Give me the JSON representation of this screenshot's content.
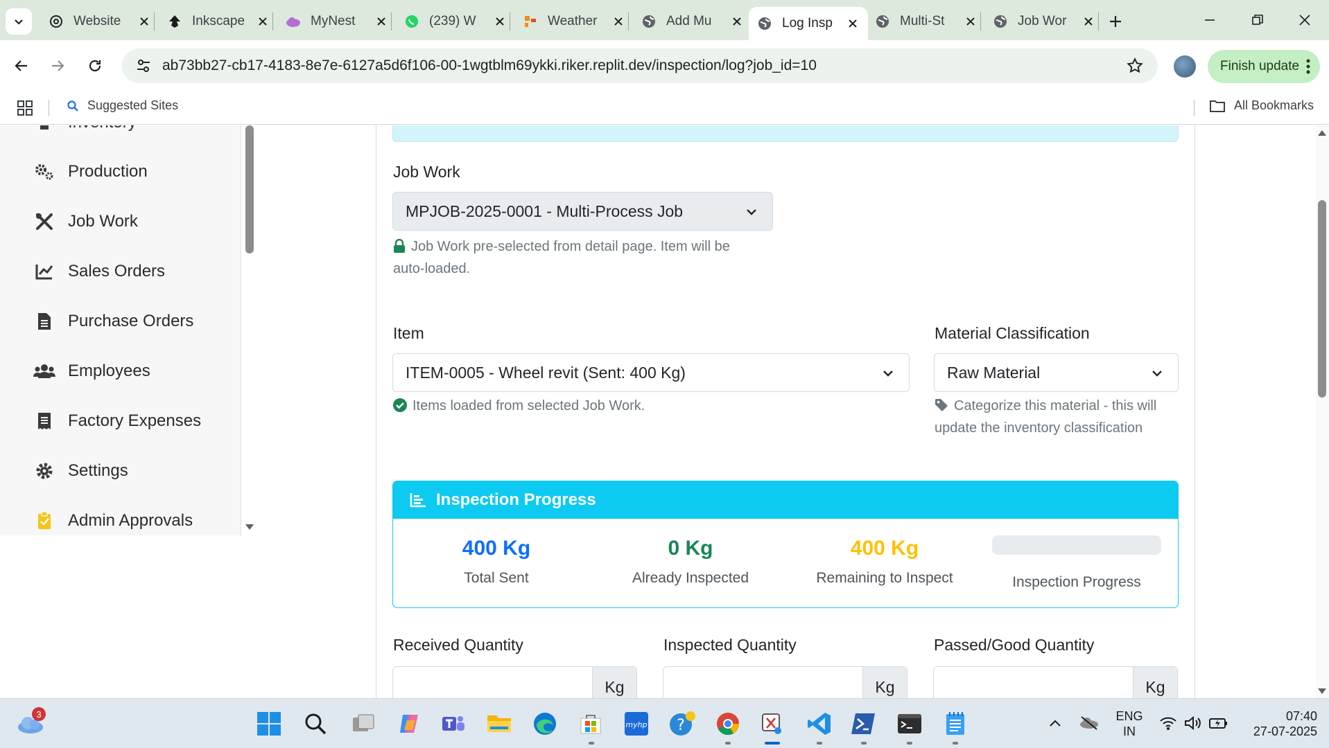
{
  "browser": {
    "tabs": [
      {
        "title": "Website",
        "icon": "openai-icon"
      },
      {
        "title": "Inkscape",
        "icon": "inkscape-icon"
      },
      {
        "title": "MyNest",
        "icon": "cloud-icon"
      },
      {
        "title": "(239) W",
        "icon": "whatsapp-icon"
      },
      {
        "title": "Weather",
        "icon": "weather-icon"
      },
      {
        "title": "Add Mu",
        "icon": "globe-icon"
      },
      {
        "title": "Log Insp",
        "icon": "globe-icon",
        "active": true
      },
      {
        "title": "Multi-St",
        "icon": "globe-icon"
      },
      {
        "title": "Job Wor",
        "icon": "globe-icon"
      }
    ],
    "url": "ab73bb27-cb17-4183-8e7e-6127a5d6f106-00-1wgtblm69ykki.riker.replit.dev/inspection/log?job_id=10",
    "finish_update_label": "Finish update",
    "bookmarks": {
      "suggested": "Suggested Sites",
      "all": "All Bookmarks"
    }
  },
  "sidebar": {
    "items": [
      {
        "label": "Inventory",
        "icon": "boxes-icon"
      },
      {
        "label": "Production",
        "icon": "cogs-icon"
      },
      {
        "label": "Job Work",
        "icon": "tools-icon"
      },
      {
        "label": "Sales Orders",
        "icon": "chart-line-icon"
      },
      {
        "label": "Purchase Orders",
        "icon": "file-invoice-icon"
      },
      {
        "label": "Employees",
        "icon": "users-icon"
      },
      {
        "label": "Factory Expenses",
        "icon": "receipt-icon"
      },
      {
        "label": "Settings",
        "icon": "gear-icon"
      },
      {
        "label": "Admin Approvals",
        "icon": "clipboard-check-icon"
      }
    ]
  },
  "form": {
    "job_work": {
      "label": "Job Work",
      "selected": "MPJOB-2025-0001 - Multi-Process Job",
      "help_line1": "Job Work pre-selected from detail page. Item will be",
      "help_line2": "auto-loaded."
    },
    "item": {
      "label": "Item",
      "selected": "ITEM-0005 - Wheel revit (Sent: 400 Kg)",
      "help": "Items loaded from selected Job Work."
    },
    "material_classification": {
      "label": "Material Classification",
      "selected": "Raw Material",
      "help_line1": "Categorize this material - this will",
      "help_line2": "update the inventory classification"
    },
    "inspection_progress": {
      "title": "Inspection Progress",
      "total_sent": {
        "value": "400 Kg",
        "caption": "Total Sent",
        "color": "#0d6efd"
      },
      "already_inspected": {
        "value": "0 Kg",
        "caption": "Already Inspected",
        "color": "#198754"
      },
      "remaining": {
        "value": "400 Kg",
        "caption": "Remaining to Inspect",
        "color": "#ffc107"
      },
      "progress_caption": "Inspection Progress",
      "progress_percent": 0
    },
    "quantities": {
      "received": {
        "label": "Received Quantity",
        "unit": "Kg",
        "value": ""
      },
      "inspected": {
        "label": "Inspected Quantity",
        "unit": "Kg",
        "value": ""
      },
      "passed": {
        "label": "Passed/Good Quantity",
        "unit": "Kg",
        "value": ""
      }
    }
  },
  "taskbar": {
    "weather_badge": "3",
    "lang_line1": "ENG",
    "lang_line2": "IN",
    "time": "07:40",
    "date": "27-07-2025"
  },
  "colors": {
    "info": "#0dcaf0",
    "primary": "#0d6efd",
    "success": "#198754",
    "warning": "#ffc107"
  }
}
